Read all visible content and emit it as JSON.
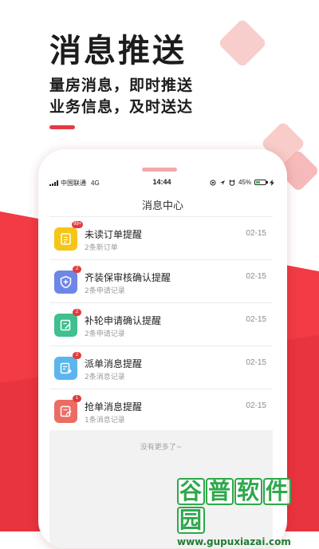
{
  "hero": {
    "title": "消息推送",
    "line1": "量房消息，即时推送",
    "line2": "业务信息，及时送达"
  },
  "status_bar": {
    "carrier": "中国联通",
    "network": "4G",
    "time": "14:44",
    "battery": "45%"
  },
  "screen": {
    "title": "消息中心",
    "footer": "没有更多了~"
  },
  "messages": [
    {
      "title": "未读订单提醒",
      "subtitle": "2条新订单",
      "date": "02-15",
      "badge": "99+",
      "icon": "clipboard-icon",
      "color": "#f5c518"
    },
    {
      "title": "齐装保审核确认提醒",
      "subtitle": "2条申请记录",
      "date": "02-15",
      "badge": "2",
      "icon": "shield-plus-icon",
      "color": "#6e86e8"
    },
    {
      "title": "补轮申请确认提醒",
      "subtitle": "2条申请记录",
      "date": "02-15",
      "badge": "2",
      "icon": "edit-document-icon",
      "color": "#3fc08e"
    },
    {
      "title": "派单消息提醒",
      "subtitle": "2条消息记录",
      "date": "02-15",
      "badge": "2",
      "icon": "send-document-icon",
      "color": "#5ab6ec"
    },
    {
      "title": "抢单消息提醒",
      "subtitle": "1条消息记录",
      "date": "02-15",
      "badge": "1",
      "icon": "grab-document-icon",
      "color": "#ec6c63"
    }
  ],
  "colors": {
    "accent": "#e63a43",
    "background_red": "#f03a43"
  },
  "watermark": {
    "chars": [
      "谷",
      "普",
      "软",
      "件",
      "园"
    ],
    "url": "www.gupuxiazai.com"
  }
}
